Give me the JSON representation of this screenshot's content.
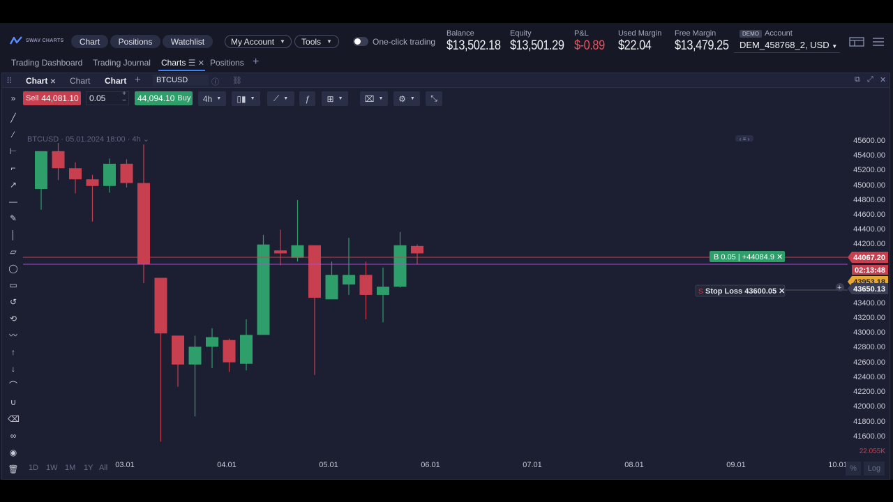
{
  "header": {
    "logo_text": "SWAV CHARTS",
    "nav": [
      "Chart",
      "Positions",
      "Watchlist"
    ],
    "my_account": "My Account",
    "tools": "Tools",
    "one_click": "One-click trading",
    "metrics": [
      {
        "label": "Balance",
        "value": "$13,502.18"
      },
      {
        "label": "Equity",
        "value": "$13,501.29"
      },
      {
        "label": "P&L",
        "value": "$-0.89"
      },
      {
        "label": "Used Margin",
        "value": "$22.04"
      },
      {
        "label": "Free Margin",
        "value": "$13,479.25"
      }
    ],
    "demo_badge": "DEMO",
    "account_label": "Account",
    "account_value": "DEM_458768_2, USD"
  },
  "tabs": [
    "Trading Dashboard",
    "Trading Journal",
    "Charts",
    "Positions"
  ],
  "chart_tabs": [
    "Chart",
    "Chart",
    "Chart"
  ],
  "symbol": "BTCUSD",
  "toolbar": {
    "sell_label": "Sell",
    "sell_price": "44,081.10",
    "quantity": "0.05",
    "buy_price": "44,094.10",
    "buy_label": "Buy",
    "timeframe": "4h"
  },
  "chart_info": "BTCUSD · 05.01.2024 18:00 · 4h",
  "price_axis": [
    "45600.00",
    "45400.00",
    "45200.00",
    "45000.00",
    "44800.00",
    "44600.00",
    "44400.00",
    "44200.00",
    "43400.00",
    "43200.00",
    "43000.00",
    "42800.00",
    "42600.00",
    "42400.00",
    "42200.00",
    "42000.00",
    "41800.00",
    "41600.00"
  ],
  "time_axis": [
    "03.01",
    "04.01",
    "05.01",
    "06.01",
    "07.01",
    "08.01",
    "09.01",
    "10.01"
  ],
  "markers": {
    "position_side": "B",
    "position_qty": "0.05",
    "position_price": "+44084.9",
    "stop_loss_prefix": "S",
    "stop_loss_label": "Stop Loss 43600.05",
    "last_price": "44067.20",
    "countdown": "02:13:48",
    "partial_price": "43953.18",
    "sl_price": "43650.13",
    "volume_label": "22.055K"
  },
  "range_buttons": [
    "1D",
    "1W",
    "1M",
    "1Y",
    "All"
  ],
  "scale_buttons": [
    "%",
    "Log"
  ],
  "colors": {
    "up": "#2e9e6a",
    "down": "#c8404f",
    "accent": "#3b82f6",
    "bg": "#1c1f31"
  },
  "chart_data": {
    "type": "candlestick",
    "series": [
      {
        "o": 45000,
        "h": 45140,
        "c": 45510,
        "l": 44720
      },
      {
        "o": 45510,
        "h": 45620,
        "c": 45280,
        "l": 45120
      },
      {
        "o": 45280,
        "h": 45360,
        "c": 45130,
        "l": 44940
      },
      {
        "o": 45130,
        "h": 45190,
        "c": 45040,
        "l": 44560
      },
      {
        "o": 45040,
        "h": 45410,
        "c": 45340,
        "l": 44950
      },
      {
        "o": 45340,
        "h": 45400,
        "c": 45080,
        "l": 45020
      },
      {
        "o": 45080,
        "h": 45600,
        "c": 43980,
        "l": 43730
      },
      {
        "o": 43800,
        "h": 43800,
        "c": 43050,
        "l": 41590
      },
      {
        "o": 43020,
        "h": 43020,
        "c": 42630,
        "l": 42330
      },
      {
        "o": 42630,
        "h": 43020,
        "c": 42870,
        "l": 41930
      },
      {
        "o": 42870,
        "h": 43120,
        "c": 43000,
        "l": 42580
      },
      {
        "o": 42960,
        "h": 42980,
        "c": 42660,
        "l": 42530
      },
      {
        "o": 42640,
        "h": 43240,
        "c": 43030,
        "l": 42550
      },
      {
        "o": 43030,
        "h": 44380,
        "c": 44250,
        "l": 43220
      },
      {
        "o": 44170,
        "h": 44450,
        "c": 44130,
        "l": 43970
      },
      {
        "o": 44070,
        "h": 44850,
        "c": 44240,
        "l": 44020
      },
      {
        "o": 44240,
        "h": 44240,
        "c": 43530,
        "l": 42490
      },
      {
        "o": 43510,
        "h": 44020,
        "c": 43840,
        "l": 43530
      },
      {
        "o": 43710,
        "h": 44340,
        "c": 43840,
        "l": 43570
      },
      {
        "o": 43840,
        "h": 44020,
        "c": 43570,
        "l": 43240
      },
      {
        "o": 43570,
        "h": 43940,
        "c": 43680,
        "l": 43200
      },
      {
        "o": 43680,
        "h": 44420,
        "c": 44240,
        "l": 43670
      },
      {
        "o": 44230,
        "h": 44250,
        "c": 44130,
        "l": 43980
      }
    ],
    "x_ticks": [
      "03.01",
      "04.01",
      "05.01",
      "06.01",
      "07.01",
      "08.01",
      "09.01",
      "10.01"
    ],
    "lines": {
      "bid": 44067.2,
      "ask": 43970,
      "position": 44084.9,
      "stop_loss": 43650.13
    }
  }
}
